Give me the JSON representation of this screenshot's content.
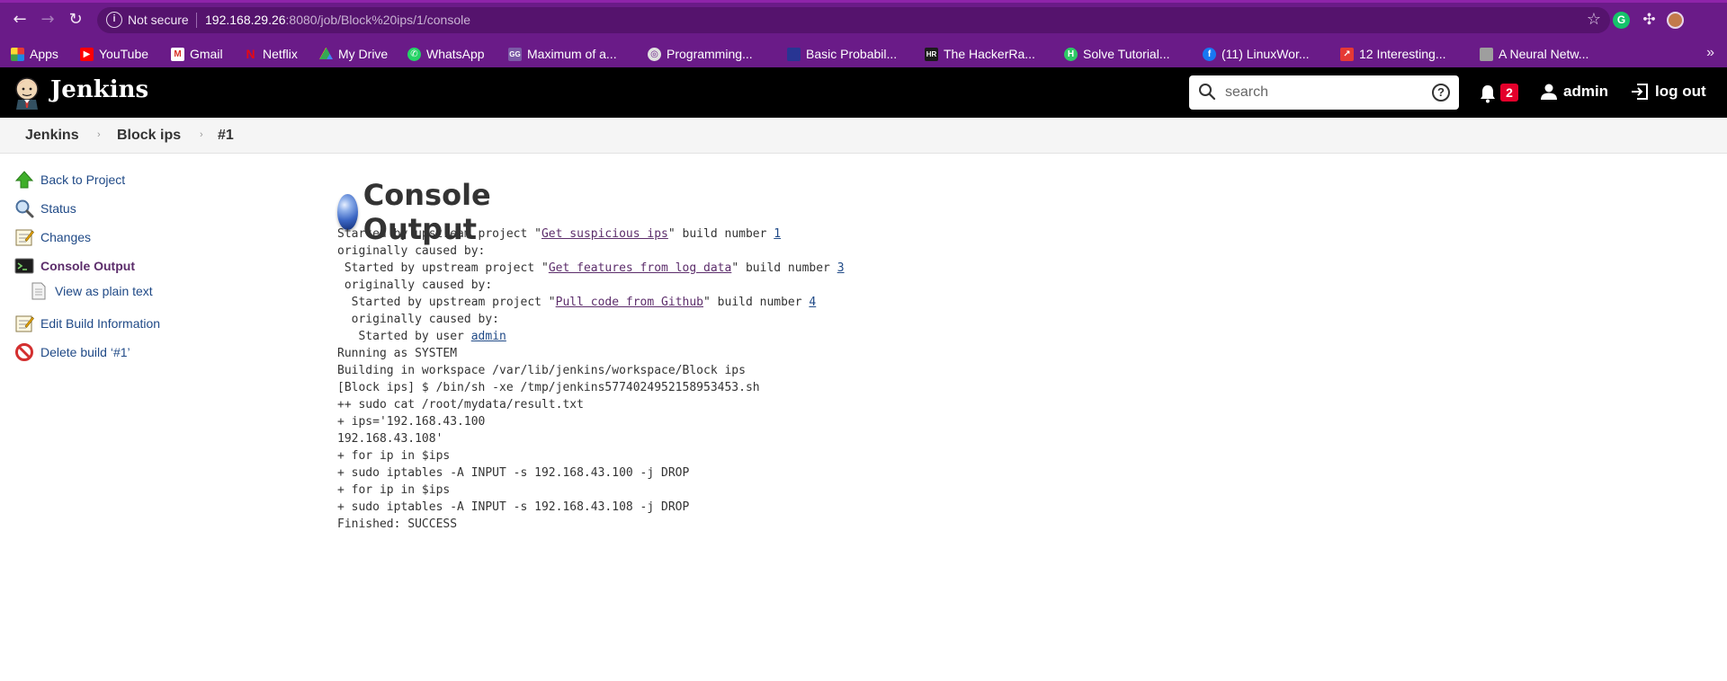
{
  "browser": {
    "not_secure": "Not secure",
    "url_host": "192.168.29.26",
    "url_rest": ":8080/job/Block%20ips/1/console",
    "bookmarks": [
      {
        "label": "Apps",
        "color": "#e53935"
      },
      {
        "label": "YouTube",
        "color": "#ff0000"
      },
      {
        "label": "Gmail",
        "color": "#d93025"
      },
      {
        "label": "Netflix",
        "color": "#e50914"
      },
      {
        "label": "My Drive",
        "color": "#34a853"
      },
      {
        "label": "WhatsApp",
        "color": "#25d366"
      },
      {
        "label": "Maximum of a...",
        "color": "#7b5aa6"
      },
      {
        "label": "Programming...",
        "color": "#e0e0e0"
      },
      {
        "label": "Basic Probabil...",
        "color": "#283593"
      },
      {
        "label": "The HackerRa...",
        "color": "#1b1b1b"
      },
      {
        "label": "Solve Tutorial...",
        "color": "#2ec866"
      },
      {
        "label": "(11) LinuxWor...",
        "color": "#1877f2"
      },
      {
        "label": "12 Interesting...",
        "color": "#e53935"
      },
      {
        "label": "A Neural Netw...",
        "color": "#9e9e9e"
      }
    ]
  },
  "header": {
    "title": "Jenkins",
    "search_placeholder": "search",
    "help": "?",
    "notification_count": "2",
    "user": "admin",
    "logout": "log out"
  },
  "breadcrumb": [
    "Jenkins",
    "Block ips",
    "#1"
  ],
  "sidebar": {
    "items": [
      {
        "label": "Back to Project",
        "icon": "up-arrow-icon"
      },
      {
        "label": "Status",
        "icon": "magnifier-icon"
      },
      {
        "label": "Changes",
        "icon": "notepad-icon"
      },
      {
        "label": "Console Output",
        "icon": "terminal-icon"
      },
      {
        "label": "View as plain text",
        "icon": "document-icon"
      },
      {
        "label": "Edit Build Information",
        "icon": "notepad-icon"
      },
      {
        "label": "Delete build ‘#1’",
        "icon": "no-entry-icon"
      }
    ]
  },
  "main": {
    "title": "Console Output",
    "console": {
      "l1_pre": "Started by upstream project \"",
      "l1_link": "Get suspicious ips",
      "l1_mid": "\" build number ",
      "l1_num": "1",
      "l2": "originally caused by:",
      "l3_pre": " Started by upstream project \"",
      "l3_link": "Get features from log data",
      "l3_mid": "\" build number ",
      "l3_num": "3",
      "l4": " originally caused by:",
      "l5_pre": "  Started by upstream project \"",
      "l5_link": "Pull code from Github",
      "l5_mid": "\" build number ",
      "l5_num": "4",
      "l6": "  originally caused by:",
      "l7_pre": "   Started by user ",
      "l7_link": "admin",
      "rest": [
        "Running as SYSTEM",
        "Building in workspace /var/lib/jenkins/workspace/Block ips",
        "[Block ips] $ /bin/sh -xe /tmp/jenkins5774024952158953453.sh",
        "++ sudo cat /root/mydata/result.txt",
        "+ ips='192.168.43.100",
        "192.168.43.108'",
        "+ for ip in $ips",
        "+ sudo iptables -A INPUT -s 192.168.43.100 -j DROP",
        "+ for ip in $ips",
        "+ sudo iptables -A INPUT -s 192.168.43.108 -j DROP",
        "Finished: SUCCESS"
      ]
    }
  }
}
